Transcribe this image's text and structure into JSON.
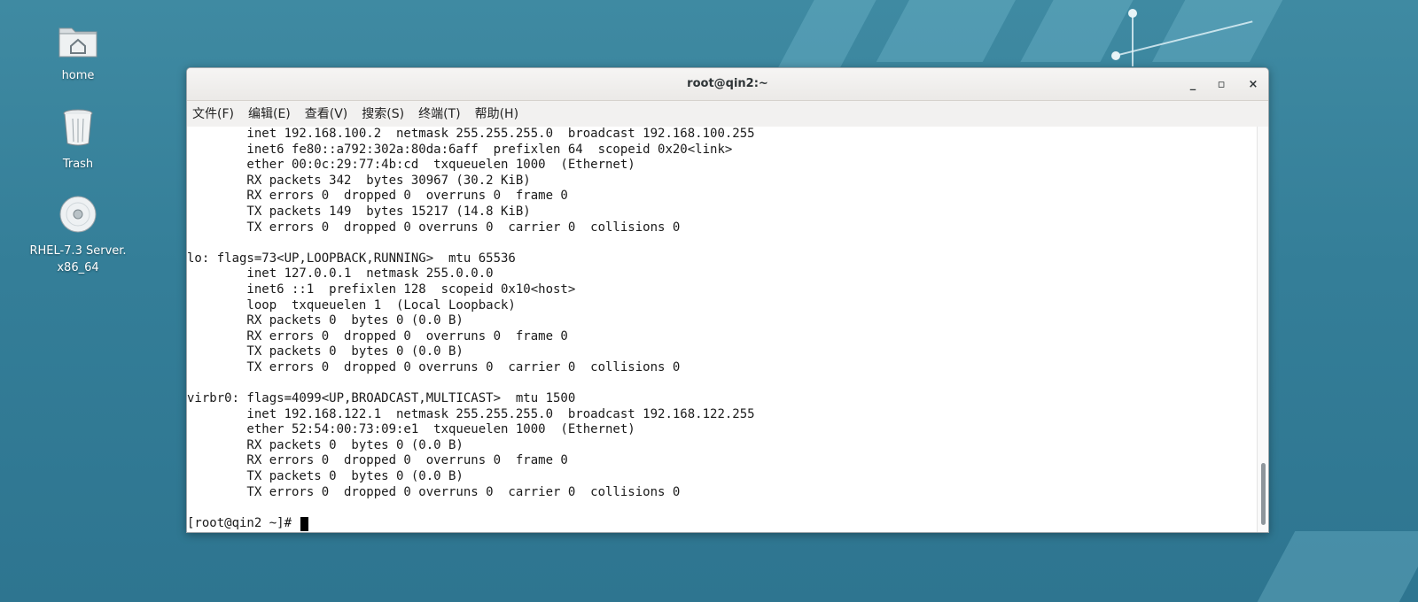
{
  "desktop": {
    "icons": [
      {
        "label": "home"
      },
      {
        "label": "Trash"
      },
      {
        "label": "RHEL-7.3 Server.\nx86_64"
      }
    ]
  },
  "window": {
    "title": "root@qin2:~",
    "buttons": {
      "minimize": "_",
      "maximize": "▫",
      "close": "×"
    }
  },
  "menu": [
    "文件(F)",
    "编辑(E)",
    "查看(V)",
    "搜索(S)",
    "终端(T)",
    "帮助(H)"
  ],
  "terminal": {
    "lines": [
      "        inet 192.168.100.2  netmask 255.255.255.0  broadcast 192.168.100.255",
      "        inet6 fe80::a792:302a:80da:6aff  prefixlen 64  scopeid 0x20<link>",
      "        ether 00:0c:29:77:4b:cd  txqueuelen 1000  (Ethernet)",
      "        RX packets 342  bytes 30967 (30.2 KiB)",
      "        RX errors 0  dropped 0  overruns 0  frame 0",
      "        TX packets 149  bytes 15217 (14.8 KiB)",
      "        TX errors 0  dropped 0 overruns 0  carrier 0  collisions 0",
      "",
      "lo: flags=73<UP,LOOPBACK,RUNNING>  mtu 65536",
      "        inet 127.0.0.1  netmask 255.0.0.0",
      "        inet6 ::1  prefixlen 128  scopeid 0x10<host>",
      "        loop  txqueuelen 1  (Local Loopback)",
      "        RX packets 0  bytes 0 (0.0 B)",
      "        RX errors 0  dropped 0  overruns 0  frame 0",
      "        TX packets 0  bytes 0 (0.0 B)",
      "        TX errors 0  dropped 0 overruns 0  carrier 0  collisions 0",
      "",
      "virbr0: flags=4099<UP,BROADCAST,MULTICAST>  mtu 1500",
      "        inet 192.168.122.1  netmask 255.255.255.0  broadcast 192.168.122.255",
      "        ether 52:54:00:73:09:e1  txqueuelen 1000  (Ethernet)",
      "        RX packets 0  bytes 0 (0.0 B)",
      "        RX errors 0  dropped 0  overruns 0  frame 0",
      "        TX packets 0  bytes 0 (0.0 B)",
      "        TX errors 0  dropped 0 overruns 0  carrier 0  collisions 0",
      ""
    ],
    "prompt": "[root@qin2 ~]# "
  },
  "colors": {
    "terminal_bg": "#ffffff",
    "terminal_fg": "#1a1a1a",
    "desktop_bg": "#3a84a0"
  },
  "icons": [
    "folder-home-icon",
    "trash-icon",
    "optical-disc-icon",
    "minimize-icon",
    "maximize-icon",
    "close-icon"
  ]
}
